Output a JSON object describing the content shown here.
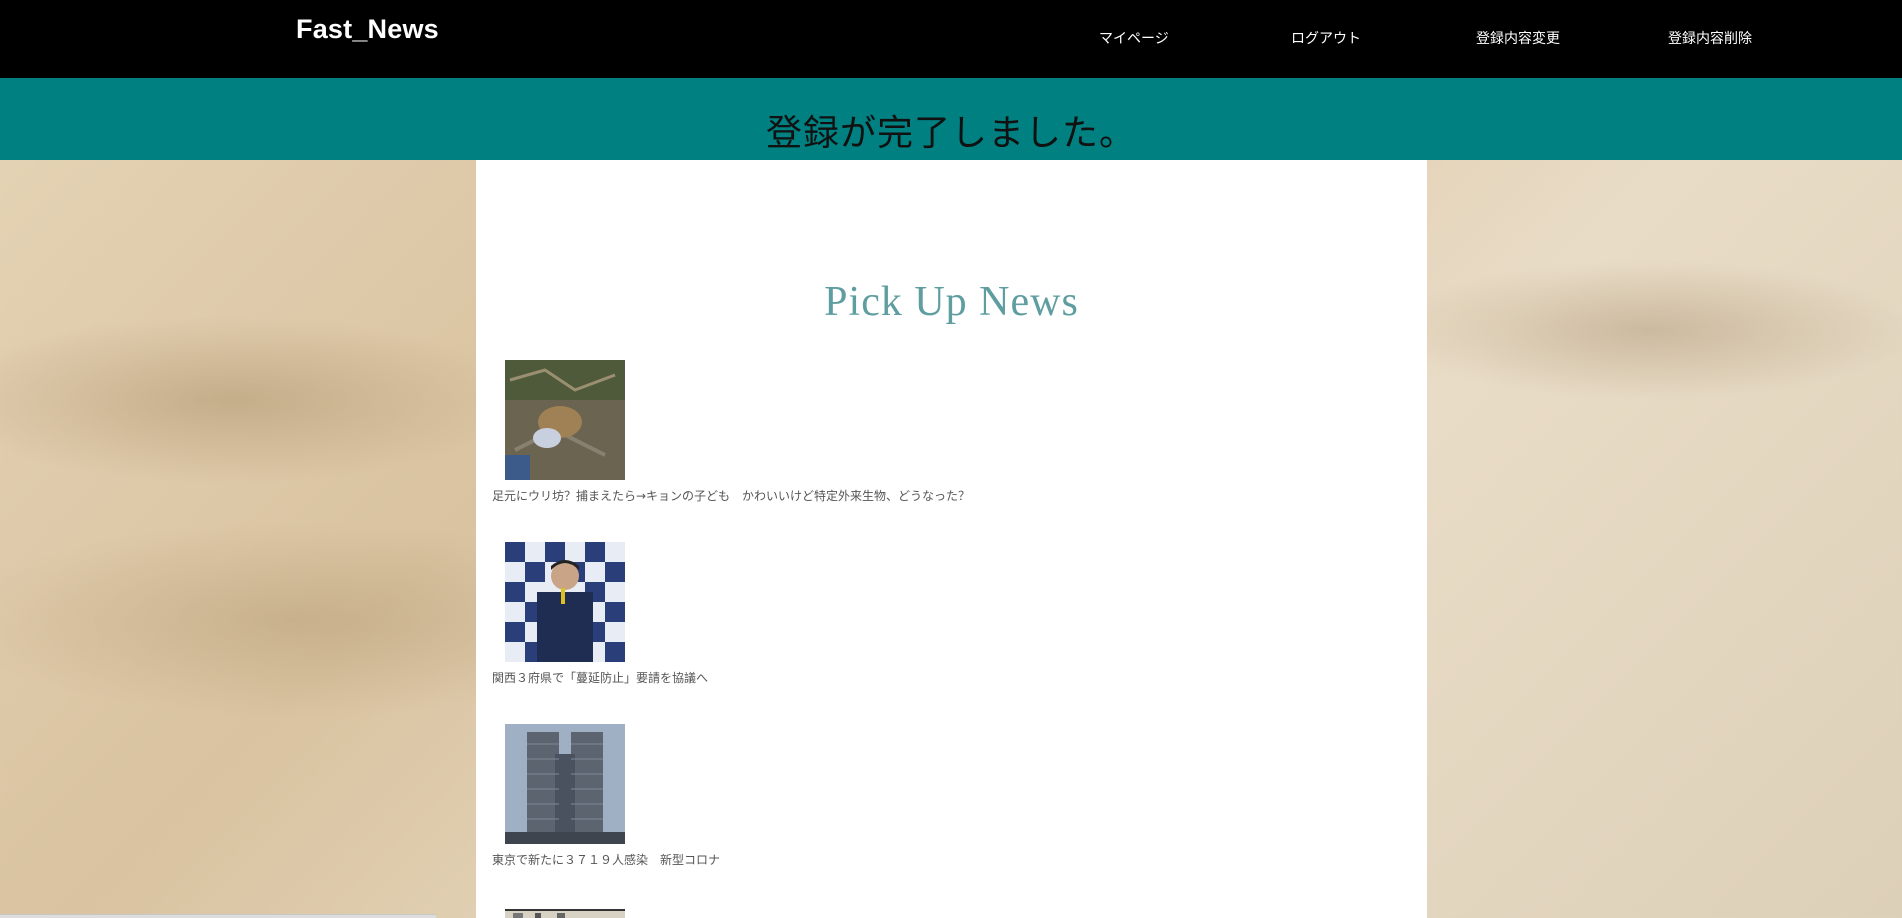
{
  "header": {
    "logo": "Fast_News",
    "nav": [
      {
        "label": "マイページ"
      },
      {
        "label": "ログアウト"
      },
      {
        "label": "登録内容変更"
      },
      {
        "label": "登録内容削除"
      }
    ]
  },
  "banner": {
    "message": "登録が完了しました。"
  },
  "main": {
    "section_title": "Pick Up News",
    "news": [
      {
        "title": "足元にウリ坊？捕まえたら→キョンの子ども　かわいいけど特定外来生物、どうなった？",
        "thumb_icon": "animal-photo-icon"
      },
      {
        "title": "関西３府県で「蔓延防止」要請を協議へ",
        "thumb_icon": "press-conference-photo-icon"
      },
      {
        "title": "東京で新たに３７１９人感染　新型コロナ",
        "thumb_icon": "building-photo-icon"
      }
    ]
  },
  "colors": {
    "topbar": "#000000",
    "banner": "#008080",
    "section_title": "#5f9ea0",
    "content_bg": "#ffffff"
  }
}
